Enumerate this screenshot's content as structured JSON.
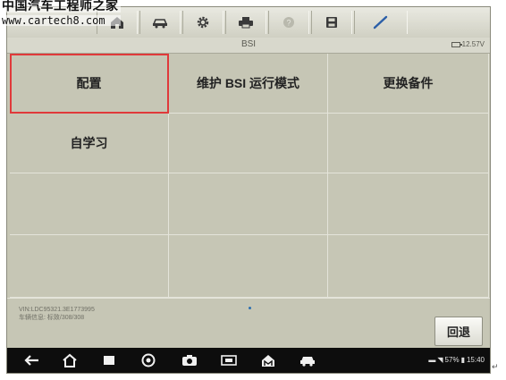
{
  "watermark": {
    "cn": "中国汽车工程师之家",
    "url": "www.cartech8.com"
  },
  "toolbar": {
    "buttons": [
      {
        "name": "home-icon"
      },
      {
        "name": "vehicle-icon"
      },
      {
        "name": "gear-icon"
      },
      {
        "name": "print-icon"
      },
      {
        "name": "help-icon"
      },
      {
        "name": "save-icon"
      },
      {
        "name": "edit-icon"
      }
    ]
  },
  "titlebar": {
    "title": "BSI",
    "voltage": "12.57V"
  },
  "menu": {
    "items": [
      "配置",
      "维护 BSI 运行模式",
      "更换备件",
      "自学习",
      "",
      "",
      "",
      "",
      "",
      "",
      "",
      ""
    ],
    "selected_index": 0
  },
  "info": {
    "vin": "VIN:LDC95321.3E1773995",
    "vehicle": "车辆信息: 标致/308/308"
  },
  "back_button": {
    "label": "回退"
  },
  "statusbar": {
    "battery": "57%",
    "time": "15:40"
  },
  "colors": {
    "selection": "#e0393a",
    "background": "#c6c6b5"
  }
}
